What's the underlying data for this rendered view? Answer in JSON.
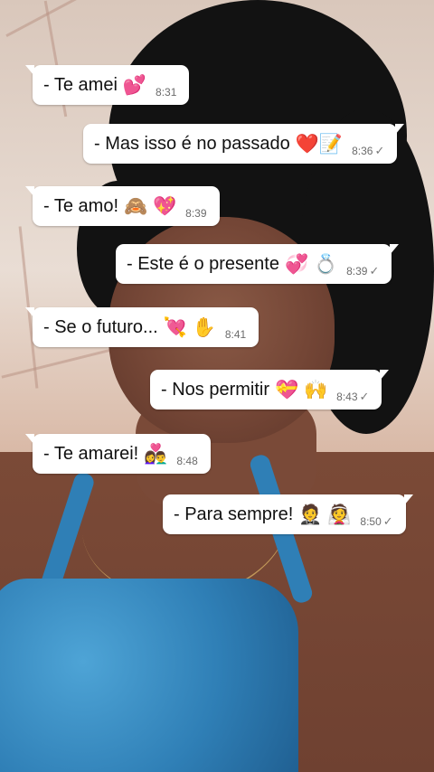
{
  "messages": [
    {
      "side": "left",
      "text": "- Te amei",
      "emojis": "💕",
      "time": "8:31",
      "read": false
    },
    {
      "side": "right",
      "text": "- Mas isso é no passado",
      "emojis": "❤️📝",
      "time": "8:36",
      "read": true
    },
    {
      "side": "left",
      "text": "-  Te amo!",
      "emojis": "🙈 💖",
      "time": "8:39",
      "read": false
    },
    {
      "side": "right",
      "text": "- Este é o presente",
      "emojis": "💞 💍",
      "time": "8:39",
      "read": true
    },
    {
      "side": "left",
      "text": "-  Se o futuro...",
      "emojis": "💘 ✋",
      "time": "8:41",
      "read": false
    },
    {
      "side": "right",
      "text": "-  Nos permitir",
      "emojis": "💝 🙌",
      "time": "8:43",
      "read": true
    },
    {
      "side": "left",
      "text": "- Te amarei!",
      "emojis": "👩‍❤️‍👨",
      "time": "8:48",
      "read": false
    },
    {
      "side": "right",
      "text": "- Para sempre!",
      "emojis": "🤵 👰",
      "time": "8:50",
      "read": true
    }
  ],
  "check_glyph": "✓"
}
